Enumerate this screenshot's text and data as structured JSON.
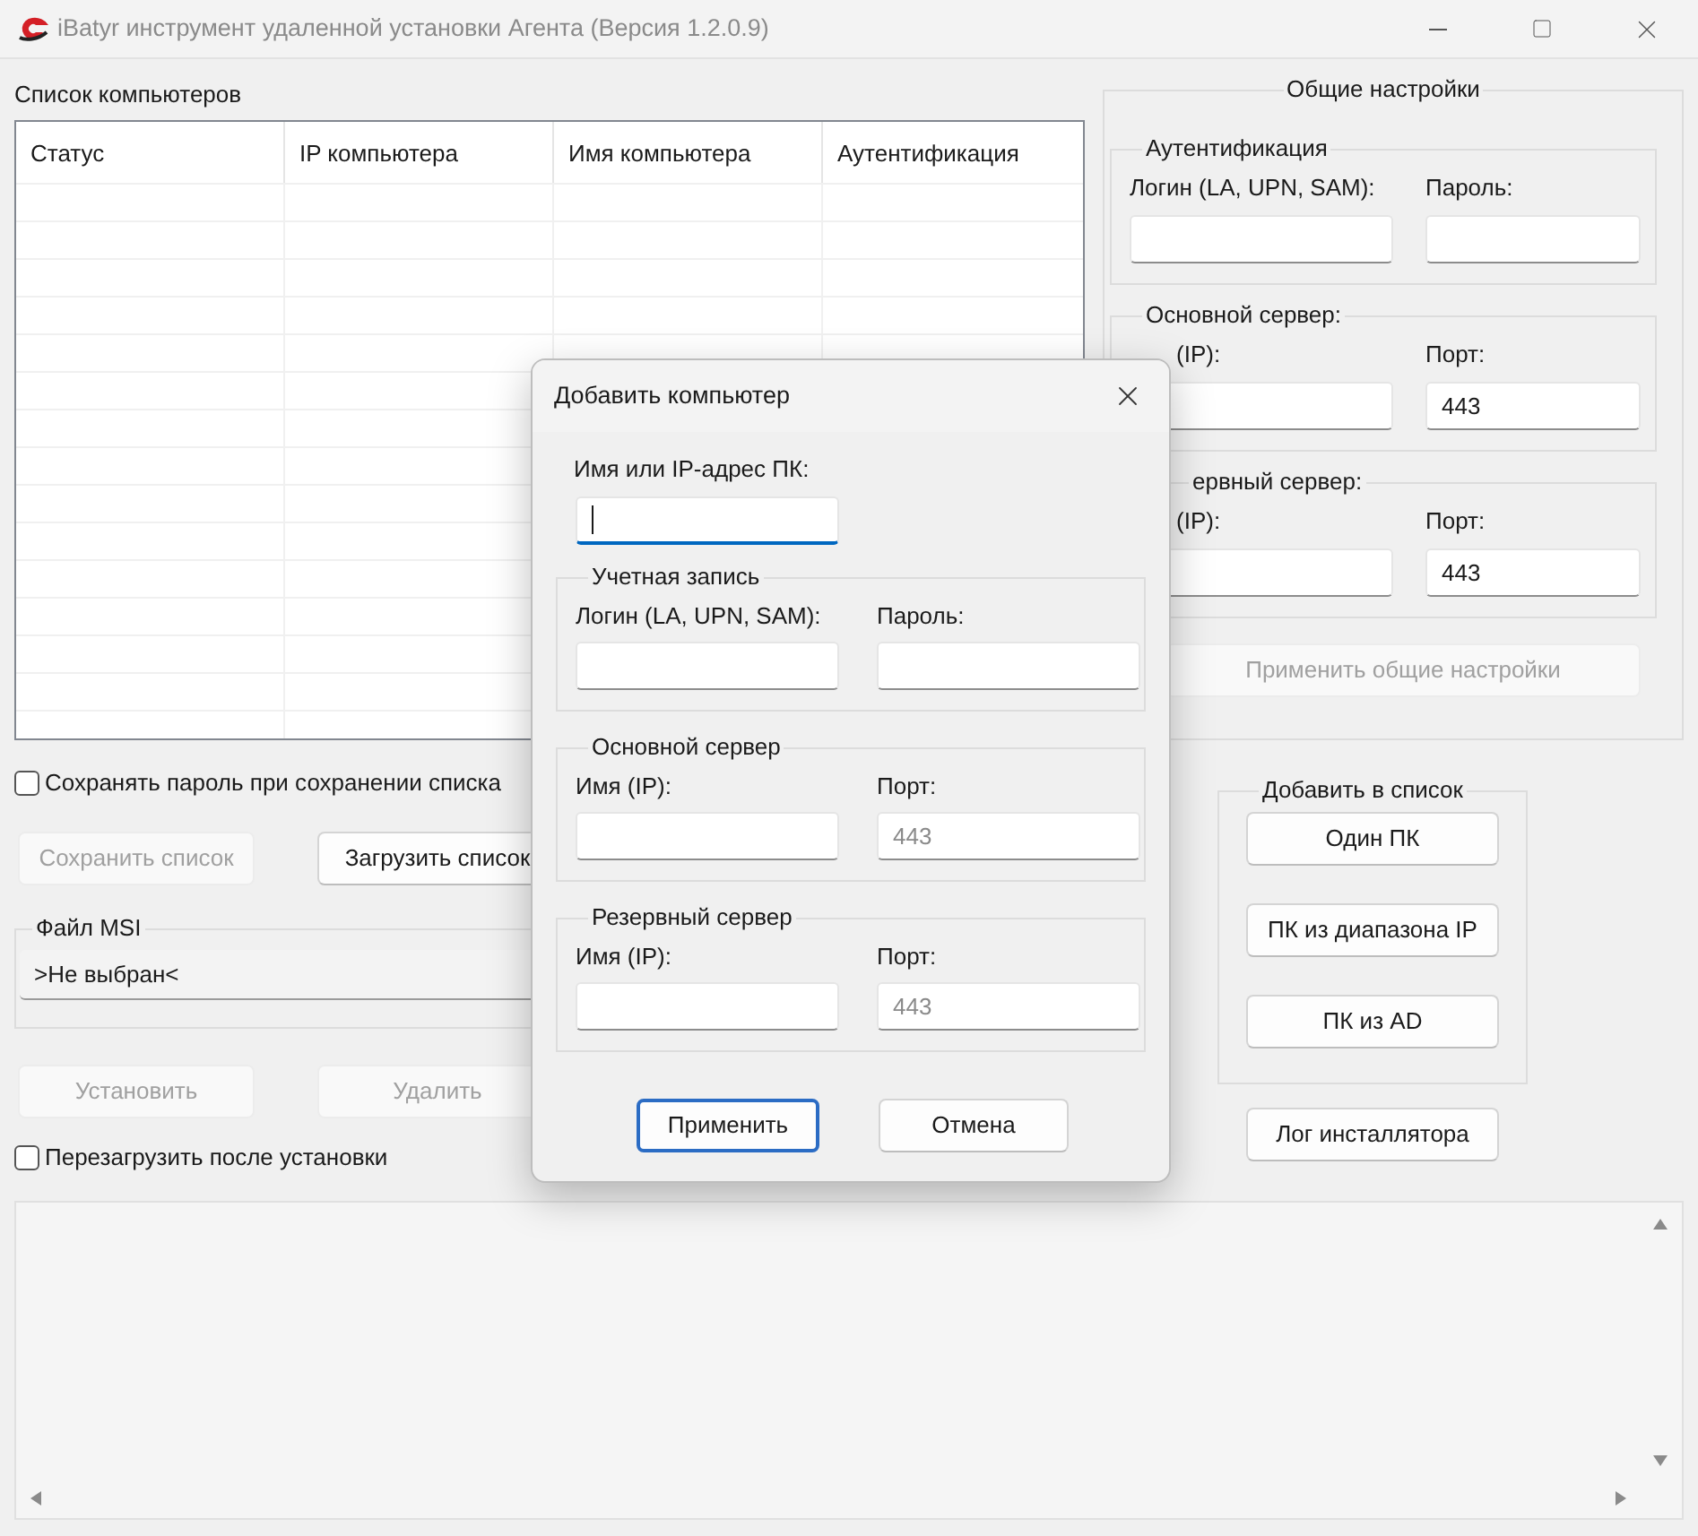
{
  "window": {
    "title": "iBatyr инструмент удаленной установки Агента (Версия 1.2.0.9)"
  },
  "computer_list": {
    "label": "Список компьютеров",
    "columns": [
      "Статус",
      "IP компьютера",
      "Имя компьютера",
      "Аутентификация"
    ]
  },
  "save_password": {
    "label": "Сохранять пароль при сохранении списка",
    "checked": false
  },
  "list_buttons": [
    {
      "label": "Сохранить список",
      "disabled": true
    },
    {
      "label": "Загрузить список",
      "disabled": false
    }
  ],
  "msi_file": {
    "legend": "Файл MSI",
    "value": ">Не выбран<"
  },
  "action_buttons": [
    {
      "label": "Установить",
      "disabled": true
    },
    {
      "label": "Удалить",
      "disabled": true
    }
  ],
  "reboot": {
    "label": "Перезагрузить после установки",
    "checked": false
  },
  "general_settings": {
    "legend": "Общие настройки",
    "groups": [
      {
        "legend": "Аутентификация",
        "fields": [
          {
            "label": "Логин (LA, UPN, SAM):"
          },
          {
            "label": "Пароль:"
          }
        ]
      },
      {
        "legend": "Основной сервер:",
        "fields": [
          {
            "label": "(IP):"
          },
          {
            "label": "Порт:",
            "value": "443"
          }
        ]
      },
      {
        "legend": "ервный сервер:",
        "fields": [
          {
            "label": "(IP):"
          },
          {
            "label": "Порт:",
            "value": "443"
          }
        ]
      }
    ],
    "apply_button": {
      "label": "Применить общие настройки",
      "disabled": true
    }
  },
  "add_to_list": {
    "legend": "Добавить в список",
    "buttons": [
      {
        "label": "Один ПК"
      },
      {
        "label": "ПК из диапазона IP"
      },
      {
        "label": "ПК из AD"
      }
    ]
  },
  "installer_log_button": {
    "label": "Лог инсталлятора"
  },
  "dialog": {
    "title": "Добавить компьютер",
    "host": {
      "label": "Имя или IP-адрес ПК:",
      "focused": true
    },
    "groups": [
      {
        "legend": "Учетная запись",
        "fields": [
          {
            "label": "Логин (LA, UPN, SAM):"
          },
          {
            "label": "Пароль:"
          }
        ]
      },
      {
        "legend": "Основной сервер",
        "fields": [
          {
            "label": "Имя (IP):"
          },
          {
            "label": "Порт:",
            "placeholder": "443"
          }
        ]
      },
      {
        "legend": "Резервный сервер",
        "fields": [
          {
            "label": "Имя (IP):"
          },
          {
            "label": "Порт:",
            "placeholder": "443"
          }
        ]
      }
    ],
    "buttons": [
      {
        "label": "Применить",
        "default": true
      },
      {
        "label": "Отмена",
        "default": false
      }
    ]
  }
}
